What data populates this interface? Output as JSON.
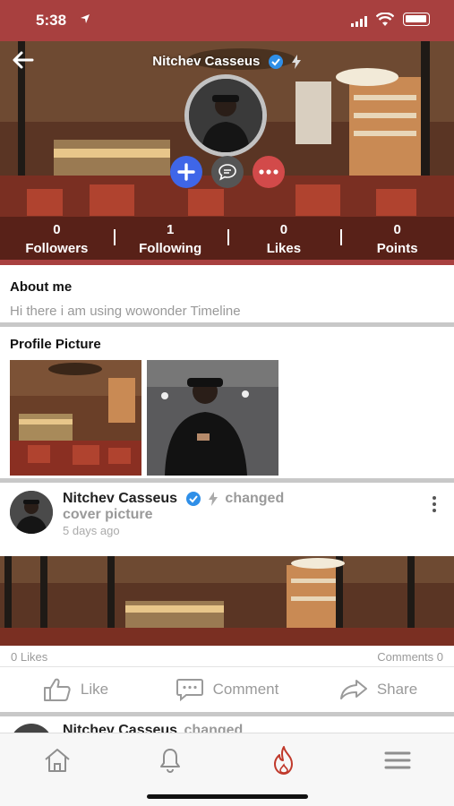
{
  "status_bar": {
    "time": "5:38"
  },
  "profile": {
    "name": "Nitchev Casseus",
    "stats": [
      {
        "value": "0",
        "label": "Followers"
      },
      {
        "value": "1",
        "label": "Following"
      },
      {
        "value": "0",
        "label": "Likes"
      },
      {
        "value": "0",
        "label": "Points"
      }
    ]
  },
  "about": {
    "title": "About me",
    "text": "Hi there i am using wowonder Timeline"
  },
  "profile_pictures": {
    "title": "Profile Picture"
  },
  "post": {
    "author": "Nitchev Casseus",
    "action_word": "changed",
    "action_rest": "cover picture",
    "time": "5 days ago",
    "likes": "0 Likes",
    "comments": "Comments 0",
    "like_label": "Like",
    "comment_label": "Comment",
    "share_label": "Share"
  },
  "next_post": {
    "author": "Nitchev Casseus",
    "action_word": "changed"
  },
  "colors": {
    "brand": "#a8403f",
    "accent_blue": "#3f66e8",
    "more_red": "#d24a4a",
    "verified": "#2f8fe8"
  },
  "tabs": [
    {
      "icon": "home-icon",
      "active": false
    },
    {
      "icon": "bell-icon",
      "active": false
    },
    {
      "icon": "flame-icon",
      "active": true
    },
    {
      "icon": "menu-icon",
      "active": false
    }
  ]
}
